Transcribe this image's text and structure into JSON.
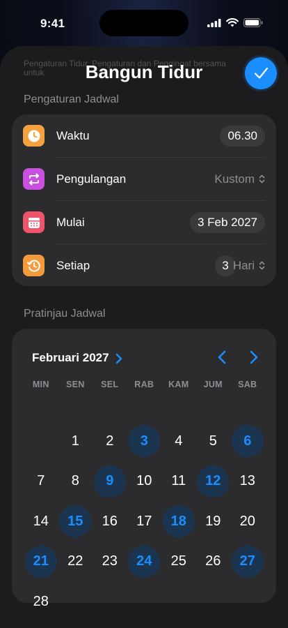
{
  "status_bar": {
    "time": "9:41"
  },
  "header": {
    "title": "Bangun Tidur",
    "faded_caption": "Pengaturan Tidur, Pengaturan dan Pengingat bersama untuk"
  },
  "settings": {
    "section_title": "Pengaturan Jadwal",
    "rows": [
      {
        "label": "Waktu",
        "value": "06.30",
        "icon": "clock-icon",
        "color": "#f5a142"
      },
      {
        "label": "Pengulangan",
        "value": "Kustom",
        "icon": "repeat-icon",
        "color": "#c94fe0"
      },
      {
        "label": "Mulai",
        "value": "3 Feb 2027",
        "icon": "calendar-icon",
        "color": "#f0546a"
      },
      {
        "label": "Setiap",
        "value": "3",
        "unit": "Hari",
        "icon": "history-icon",
        "color": "#f59a3a"
      }
    ]
  },
  "preview": {
    "section_title": "Pratinjau Jadwal",
    "month_label": "Februari 2027",
    "weekdays": [
      "MIN",
      "SEN",
      "SEL",
      "RAB",
      "KAM",
      "JUM",
      "SAB"
    ],
    "days": [
      "1",
      "2",
      "3",
      "4",
      "5",
      "6",
      "7",
      "8",
      "9",
      "10",
      "11",
      "12",
      "13",
      "14",
      "15",
      "16",
      "17",
      "18",
      "19",
      "20",
      "21",
      "22",
      "23",
      "24",
      "25",
      "26",
      "27",
      "28"
    ],
    "selected_days": [
      "3",
      "6",
      "9",
      "12",
      "15",
      "18",
      "21",
      "24",
      "27"
    ],
    "accent": "#1a8dff"
  }
}
